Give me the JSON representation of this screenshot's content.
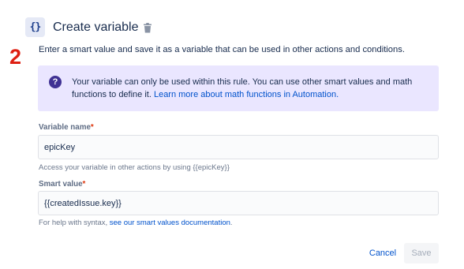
{
  "annotation": {
    "step_number": "2"
  },
  "header": {
    "icon_glyph": "{}",
    "icon_name": "curly-braces-icon",
    "title": "Create variable",
    "delete_icon_name": "trash-icon"
  },
  "description": "Enter a smart value and save it as a variable that can be used in other actions and conditions.",
  "info_panel": {
    "icon_glyph": "?",
    "text": "Your variable can only be used within this rule. You can use other smart values and math functions to define it. ",
    "link_text": "Learn more about math functions in Automation."
  },
  "variable_name": {
    "label": "Variable name",
    "required_marker": "*",
    "value": "epicKey",
    "help": "Access your variable in other actions by using {{epicKey}}"
  },
  "smart_value": {
    "label": "Smart value",
    "required_marker": "*",
    "value": "{{createdIssue.key}}",
    "help_prefix": "For help with syntax, ",
    "help_link": "see our smart values documentation",
    "help_suffix": "."
  },
  "footer": {
    "cancel_label": "Cancel",
    "save_label": "Save"
  },
  "colors": {
    "accent": "#0052cc",
    "info_background": "#eae6ff",
    "info_icon": "#403294",
    "step_number": "#de1f12",
    "required": "#de350b"
  }
}
